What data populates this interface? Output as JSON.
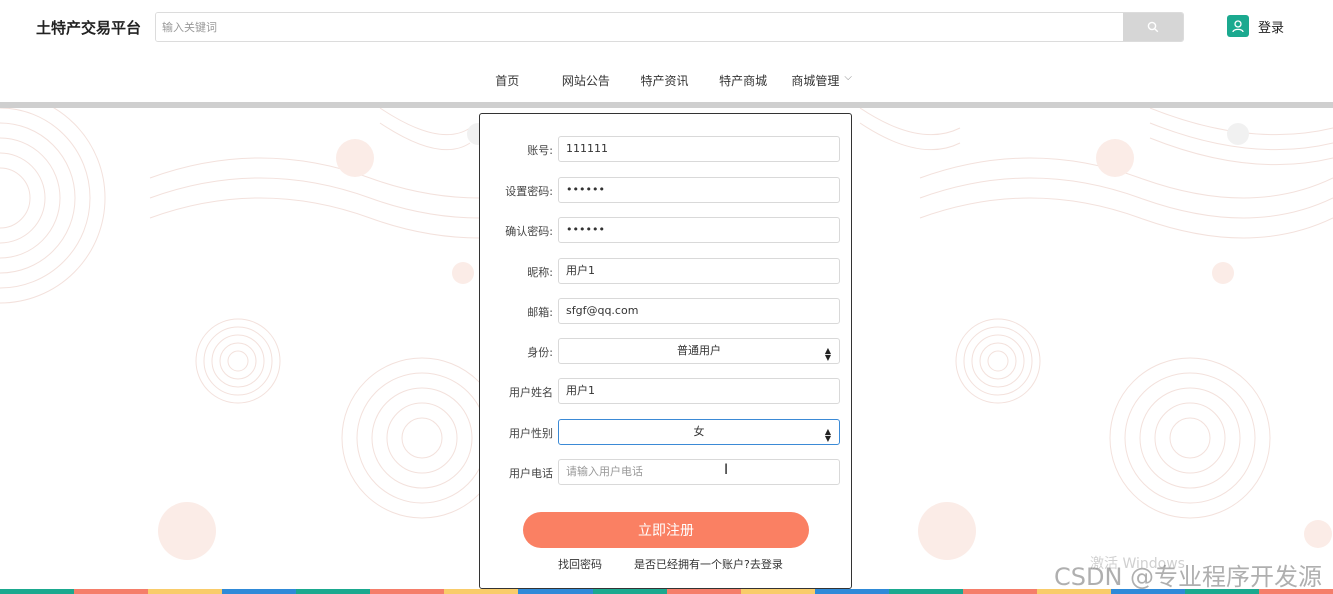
{
  "header": {
    "logo": "土特产交易平台",
    "search_placeholder": "输入关键词",
    "login_label": "登录"
  },
  "nav": {
    "items": [
      {
        "label": "首页",
        "color": "#1ba98f"
      },
      {
        "label": "网站公告",
        "color": "#f57e6a"
      },
      {
        "label": "特产资讯",
        "color": "#f9cc6a"
      },
      {
        "label": "特产商城",
        "color": "#2f8ad8"
      },
      {
        "label": "商城管理",
        "color": "#1ba98f"
      }
    ]
  },
  "form": {
    "account_label": "账号:",
    "account_value": "111111",
    "password_label": "设置密码:",
    "password_value": "••••••",
    "confirm_label": "确认密码:",
    "confirm_value": "••••••",
    "nickname_label": "昵称:",
    "nickname_value": "用户1",
    "email_label": "邮箱:",
    "email_value": "sfgf@qq.com",
    "role_label": "身份:",
    "role_value": "普通用户",
    "name_label": "用户姓名",
    "name_value": "用户1",
    "gender_label": "用户性别",
    "gender_value": "女",
    "phone_label": "用户电话",
    "phone_placeholder": "请输入用户电话",
    "submit_label": "立即注册",
    "forgot_label": "找回密码",
    "has_account_label": "是否已经拥有一个账户?去登录"
  },
  "watermark": {
    "text": "CSDN @专业程序开发源",
    "activation": "激活 Windows"
  }
}
